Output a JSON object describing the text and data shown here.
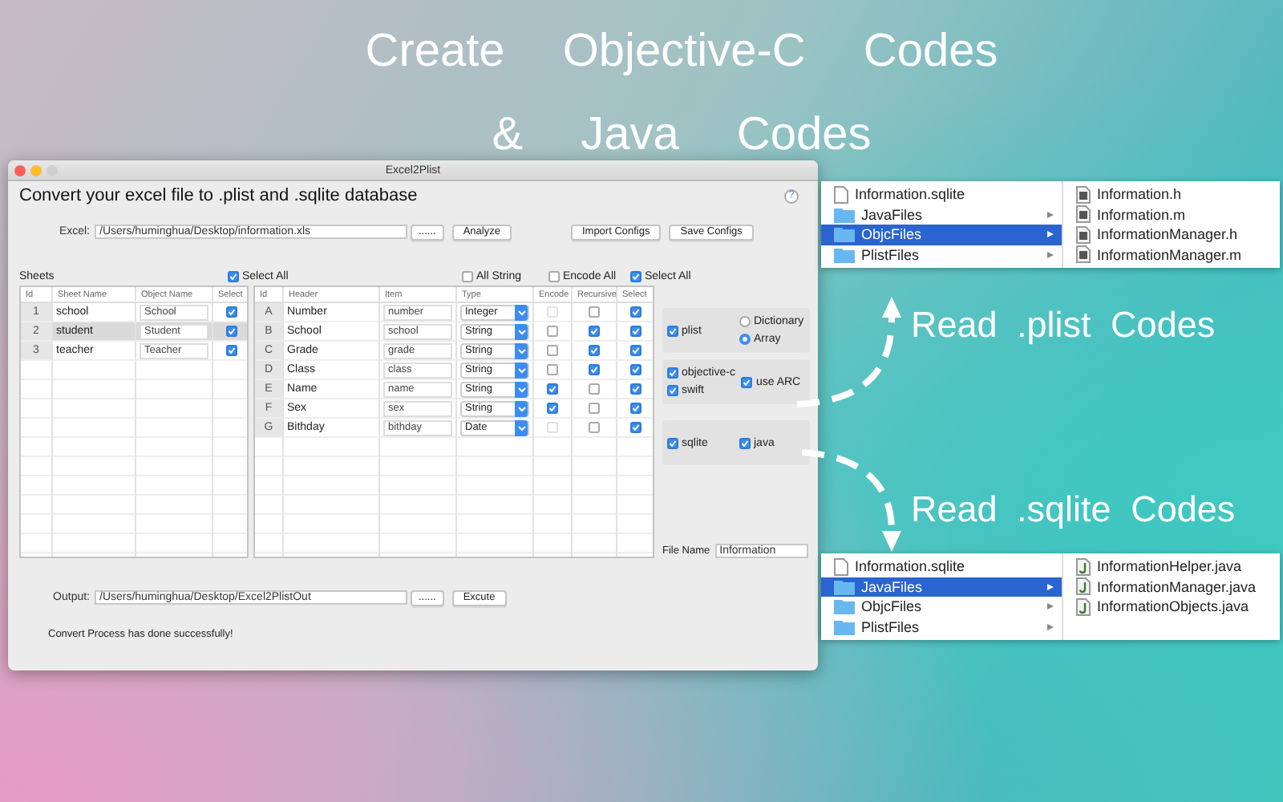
{
  "headline": [
    "Create Objective-C Codes",
    "& Java Codes"
  ],
  "window": {
    "title": "Excel2Plist",
    "heading": "Convert your excel file to .plist and .sqlite database",
    "help": "?",
    "excel": {
      "label": "Excel:",
      "value": "/Users/huminghua/Desktop/information.xls",
      "browse": "......"
    },
    "buttons": {
      "analyze": "Analyze",
      "import": "Import Configs",
      "save": "Save Configs"
    },
    "sheets": {
      "label": "Sheets",
      "select_all": {
        "label": "Select All",
        "checked": true
      },
      "columns": [
        "Id",
        "Sheet Name",
        "Object Name",
        "Select"
      ],
      "rows": [
        {
          "id": "1",
          "name": "school",
          "object": "School",
          "checked": true,
          "selected": false
        },
        {
          "id": "2",
          "name": "student",
          "object": "Student",
          "checked": true,
          "selected": true
        },
        {
          "id": "3",
          "name": "teacher",
          "object": "Teacher",
          "checked": true,
          "selected": false
        }
      ]
    },
    "fields": {
      "options": [
        {
          "label": "All String",
          "checked": false
        },
        {
          "label": "Encode All",
          "checked": false
        },
        {
          "label": "Select All",
          "checked": true
        }
      ],
      "columns": [
        "Id",
        "Header",
        "Item",
        "Type",
        "Encode",
        "Recursive",
        "Select"
      ],
      "rows": [
        {
          "id": "A",
          "header": "Number",
          "item": "number",
          "type": "Integer",
          "encode": false,
          "encode_disabled": true,
          "recursive": false,
          "select": true
        },
        {
          "id": "B",
          "header": "School",
          "item": "school",
          "type": "String",
          "encode": false,
          "encode_disabled": false,
          "recursive": true,
          "select": true
        },
        {
          "id": "C",
          "header": "Grade",
          "item": "grade",
          "type": "String",
          "encode": false,
          "encode_disabled": false,
          "recursive": true,
          "select": true
        },
        {
          "id": "D",
          "header": "Class",
          "item": "class",
          "type": "String",
          "encode": false,
          "encode_disabled": false,
          "recursive": true,
          "select": true
        },
        {
          "id": "E",
          "header": "Name",
          "item": "name",
          "type": "String",
          "encode": true,
          "encode_disabled": false,
          "recursive": false,
          "select": true
        },
        {
          "id": "F",
          "header": "Sex",
          "item": "sex",
          "type": "String",
          "encode": true,
          "encode_disabled": false,
          "recursive": false,
          "select": true
        },
        {
          "id": "G",
          "header": "Bithday",
          "item": "bithday",
          "type": "Date",
          "encode": false,
          "encode_disabled": true,
          "recursive": false,
          "select": true
        }
      ]
    },
    "export": {
      "groups": [
        {
          "left": [
            {
              "label": "plist",
              "checked": true
            }
          ],
          "radios": [
            {
              "label": "Dictionary",
              "selected": false
            },
            {
              "label": "Array",
              "selected": true
            }
          ]
        },
        {
          "left": [
            {
              "label": "objective-c",
              "checked": true
            },
            {
              "label": "swift",
              "checked": true
            }
          ],
          "right": [
            {
              "label": "use ARC",
              "checked": true
            }
          ]
        },
        {
          "left": [
            {
              "label": "sqlite",
              "checked": true
            }
          ],
          "right": [
            {
              "label": "java",
              "checked": true
            }
          ]
        }
      ],
      "file_name": {
        "label": "File Name",
        "value": "Information"
      }
    },
    "output": {
      "label": "Output:",
      "value": "/Users/huminghua/Desktop/Excel2PlistOut",
      "browse": "......",
      "run": "Excute"
    },
    "status": "Convert Process has done successfully!"
  },
  "finders": [
    {
      "caption": "Read .plist Codes",
      "items": [
        {
          "name": "Information.sqlite",
          "kind": "file",
          "selected": false
        },
        {
          "name": "JavaFiles",
          "kind": "folder",
          "selected": false
        },
        {
          "name": "ObjcFiles",
          "kind": "folder",
          "selected": true
        },
        {
          "name": "PlistFiles",
          "kind": "folder",
          "selected": false
        }
      ],
      "files": [
        {
          "name": "Information.h",
          "kind": "objc"
        },
        {
          "name": "Information.m",
          "kind": "objc"
        },
        {
          "name": "InformationManager.h",
          "kind": "objc"
        },
        {
          "name": "InformationManager.m",
          "kind": "objc"
        }
      ]
    },
    {
      "caption": "Read .sqlite Codes",
      "items": [
        {
          "name": "Information.sqlite",
          "kind": "file",
          "selected": false
        },
        {
          "name": "JavaFiles",
          "kind": "folder",
          "selected": true
        },
        {
          "name": "ObjcFiles",
          "kind": "folder",
          "selected": false
        },
        {
          "name": "PlistFiles",
          "kind": "folder",
          "selected": false
        }
      ],
      "files": [
        {
          "name": "InformationHelper.java",
          "kind": "java"
        },
        {
          "name": "InformationManager.java",
          "kind": "java"
        },
        {
          "name": "InformationObjects.java",
          "kind": "java"
        }
      ]
    }
  ]
}
